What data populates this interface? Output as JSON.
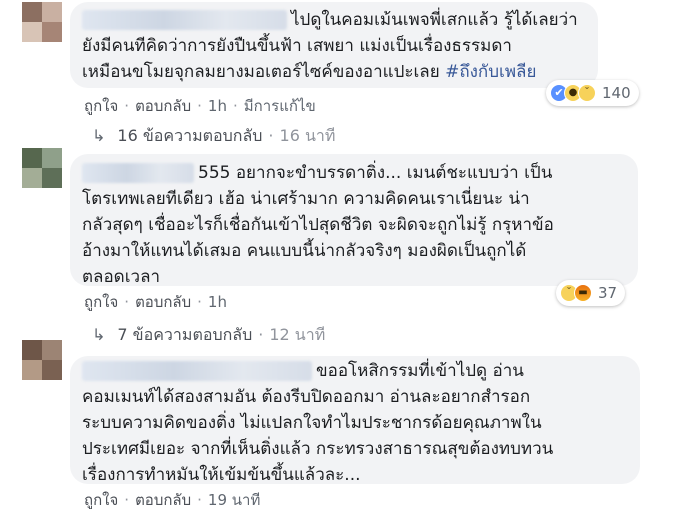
{
  "comments": [
    {
      "lines": [
        "ไปดูในคอมเม้นเพจพี่เสกแล้ว รู้ได้เลยว่า",
        "ยังมีคนทีคิดว่าการยังปืนขึ้นฟ้า เสพยา แม่งเป็นเรื่องธรรมดา"
      ],
      "line3_text": "เหมือนขโมยจุกลมยางมอเตอร์ไซค์ของอาแปะเลย ",
      "hashtag": "#ถึงกับเพลีย",
      "actions": {
        "like": "ถูกใจ",
        "reply": "ตอบกลับ",
        "time": "1h",
        "edited": "มีการแก้ไข"
      },
      "reactions": {
        "count": "140",
        "types": [
          "like",
          "wow",
          "sad"
        ]
      },
      "replies": {
        "label": "16 ข้อความตอบกลับ",
        "time": "16 นาที"
      }
    },
    {
      "lines": [
        "555 อยากจะขำบรรดาติ่ง... เมนต์ชะแบบว่า เป็น",
        "โตรเทพเลยทีเดียว เฮ้อ น่าเศร้ามาก ความคิดคนเราเนี่ยนะ น่า",
        "กลัวสุดๆ เชื่ออะไรก็เชื่อกันเข้าไปสุดชีวิต จะผิดจะถูกไม่รู้ กรุหาข้อ",
        "อ้างมาให้แทนได้เสมอ คนแบบนี้น่ากลัวจริงๆ มองผิดเป็นถูกได้",
        "ตลอดเวลา"
      ],
      "actions": {
        "like": "ถูกใจ",
        "reply": "ตอบกลับ",
        "time": "1h"
      },
      "reactions": {
        "count": "37",
        "types": [
          "sad",
          "angry"
        ]
      },
      "replies": {
        "label": "7 ข้อความตอบกลับ",
        "time": "12 นาที"
      }
    },
    {
      "lines": [
        "ขออโหสิกรรมที่เข้าไปดู อ่าน",
        "คอมเมนท์ได้สองสามอัน ต้องรีบปิดออกมา อ่านละอยากสำรอก",
        "ระบบความคิดของติ่ง ไม่แปลกใจทำไมประชากรด้อยคุณภาพใน",
        "ประเทศมีเยอะ จากที่เห็นติ่งแล้ว กระทรวงสาธารณสุขต้องทบทวน",
        "เรื่องการทำหมันให้เข้มข้นขึ้นแล้วละ..."
      ],
      "actions": {
        "like": "ถูกใจ",
        "reply": "ตอบกลับ",
        "time": "19 นาที"
      }
    }
  ],
  "colors": {
    "bubble_bg": "#f2f3f5",
    "text": "#1c1e21",
    "meta": "#606770",
    "hashtag": "#385898",
    "like_blue": "#5890ff"
  },
  "icons": {
    "reply_arrow": "↳",
    "like": "👍",
    "wow": "😮",
    "sad": "😢",
    "angry": "😠"
  }
}
